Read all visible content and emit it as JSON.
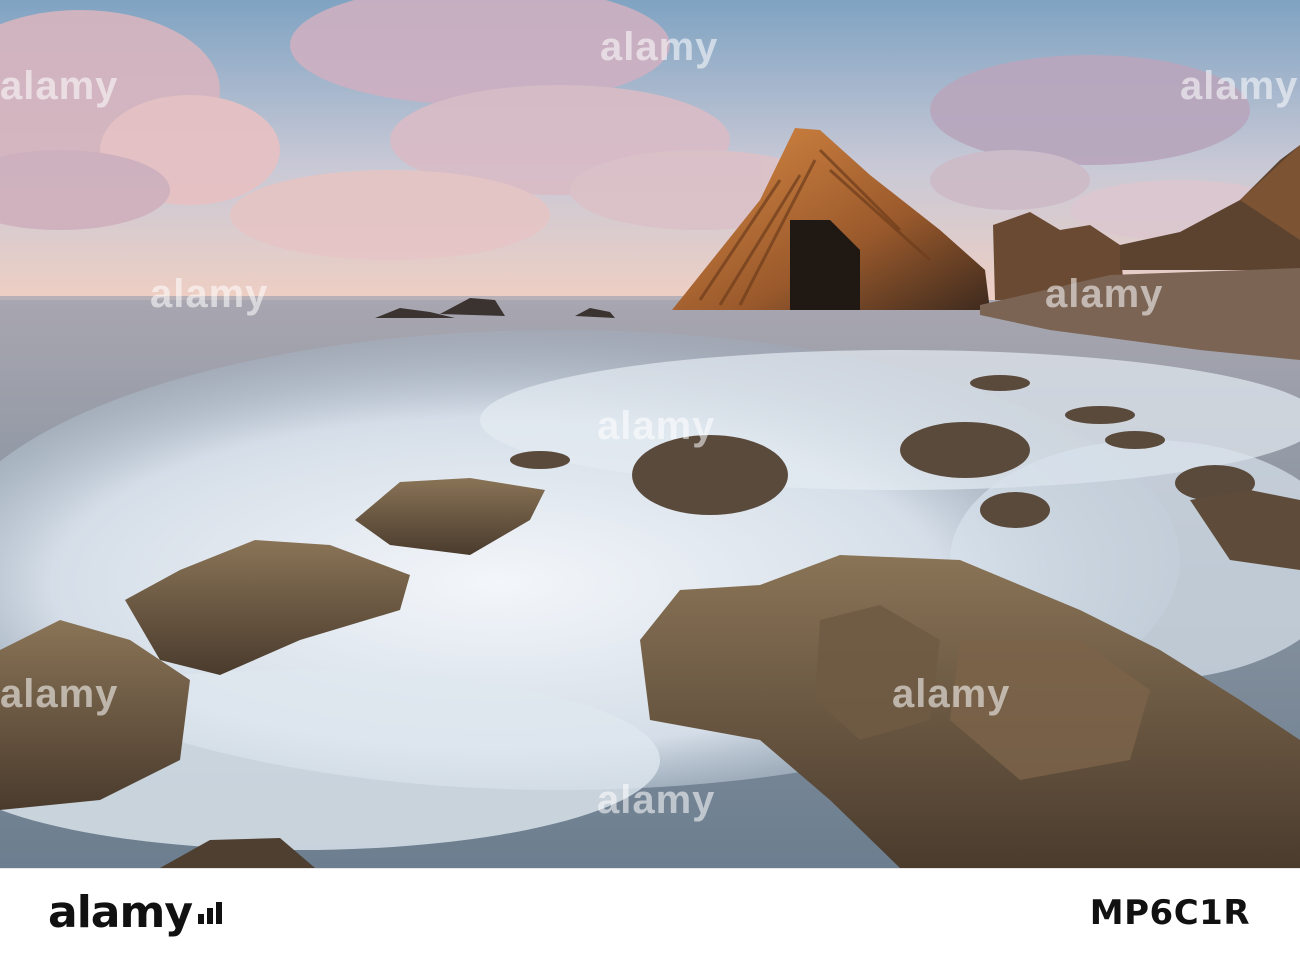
{
  "photo": {
    "description_icon": "seascape-photo",
    "colors": {
      "sky_top": "#8fb0c9",
      "sky_glow": "#f2c7b8",
      "cloud": "#d9b7be",
      "sea": "#7f8f9e",
      "surf": "#e8eef4",
      "rock_lit": "#c8773a",
      "rock_dark": "#3a2e26",
      "boulder": "#6b5a47"
    }
  },
  "watermarks": {
    "top_left": "alamy",
    "top_center": "alamy",
    "top_right": "alamy",
    "middle_left": "alamy",
    "middle_center": "alamy",
    "middle_right": "alamy",
    "bottom_left": "alamy",
    "bottom_center": "alamy",
    "bottom_right": "alamy"
  },
  "footer": {
    "brand": "alamy",
    "image_id": "MP6C1R"
  }
}
